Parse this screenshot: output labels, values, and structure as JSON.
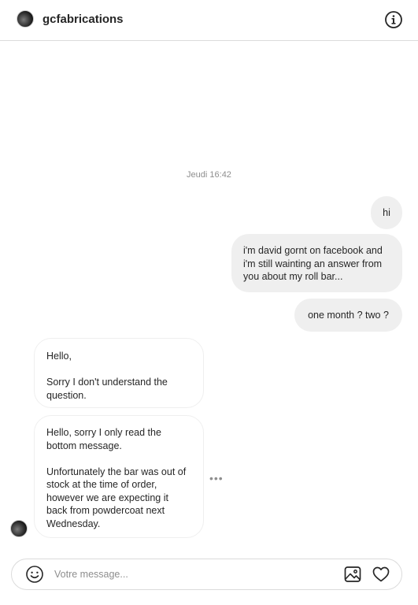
{
  "header": {
    "username": "gcfabrications",
    "info_icon": "info-icon"
  },
  "conversation": {
    "timestamp": "Jeudi 16:42",
    "messages": [
      {
        "direction": "sent",
        "text": "hi"
      },
      {
        "direction": "sent",
        "text": "i'm david gornt on facebook and i'm still wainting an answer from you about my roll bar..."
      },
      {
        "direction": "sent",
        "text": "one month ? two ?"
      },
      {
        "direction": "received",
        "text": "Hello,\n\nSorry I don't understand the question."
      },
      {
        "direction": "received",
        "text": "Hello, sorry I only read the bottom message.\n\nUnfortunately the bar was out of stock at the time of order, however we are expecting it back from powdercoat next Wednesday."
      }
    ],
    "more_options": "•••"
  },
  "composer": {
    "placeholder": "Votre message...",
    "value": "",
    "icons": [
      "emoji-icon",
      "image-icon",
      "heart-icon"
    ]
  }
}
